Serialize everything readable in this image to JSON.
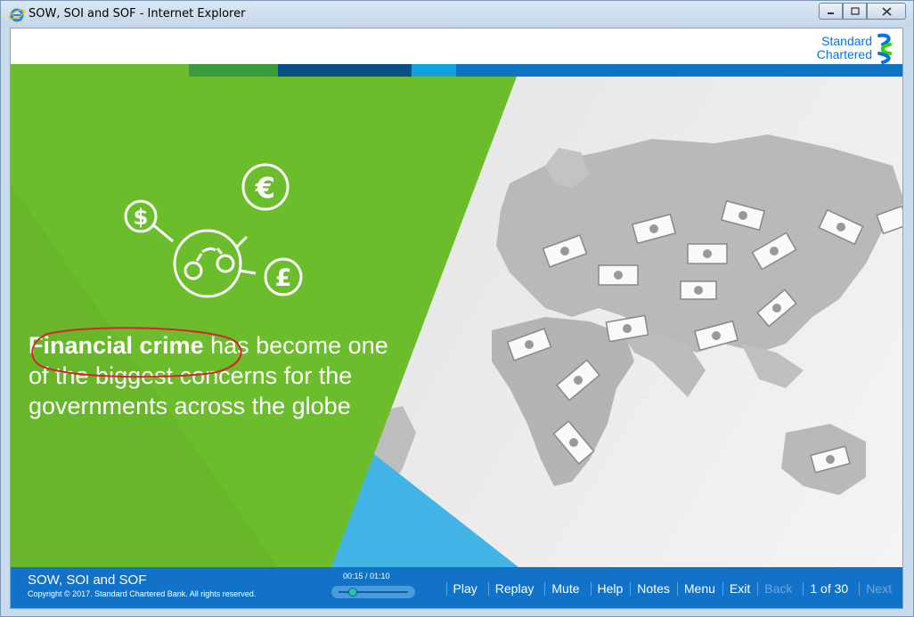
{
  "window": {
    "title": "SOW, SOI and SOF - Internet Explorer",
    "controls": [
      "minimize-icon",
      "maximize-icon",
      "close-icon"
    ]
  },
  "header": {
    "logo_line1": "Standard",
    "logo_line2": "Chartered",
    "stripe_colors": [
      "#6cbd2c",
      "#3c9a3f",
      "#0a4f86",
      "#12a1e0",
      "#0473ea"
    ]
  },
  "slide": {
    "headline_bold": "Financial crime",
    "headline_rest": " has become one of the biggest concerns for the governments across the globe",
    "icons": [
      "dollar-icon",
      "euro-icon",
      "pound-icon",
      "handcuffs-icon"
    ],
    "accent_green": "#6cbd2c",
    "accent_blue": "#43b4e6"
  },
  "footer": {
    "course_title": "SOW, SOI and SOF",
    "copyright": "Copyright © 2017. Standard Chartered Bank. All rights reserved.",
    "time": "00:15 / 01:10",
    "progress_fraction": 0.21,
    "nav": {
      "play": "Play",
      "replay": "Replay",
      "mute": "Mute",
      "help": "Help",
      "notes": "Notes",
      "menu": "Menu",
      "exit": "Exit",
      "back": "Back",
      "page": "1 of 30",
      "next": "Next"
    }
  }
}
